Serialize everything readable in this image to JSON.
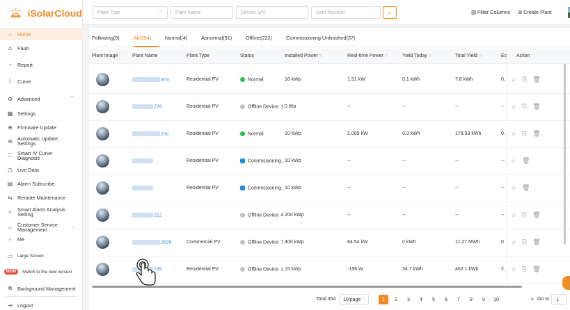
{
  "app": {
    "brand": "iSolarCloud",
    "accent": "#f08a24"
  },
  "sidebar": {
    "items": [
      {
        "label": "Home",
        "icon": "home-icon",
        "glyph": "⌂",
        "active": true
      },
      {
        "label": "Fault",
        "icon": "warning-icon",
        "glyph": "⚠"
      },
      {
        "label": "Report",
        "icon": "report-icon",
        "glyph": "◔"
      },
      {
        "label": "Curve",
        "icon": "curve-icon",
        "glyph": "⌇"
      },
      {
        "label": "Advanced",
        "icon": "advanced-icon",
        "glyph": "⚙",
        "chevron": "﹀"
      },
      {
        "label": "Settings",
        "icon": "settings-icon",
        "glyph": "▦"
      },
      {
        "label": "Firmware Update",
        "icon": "firmware-icon",
        "glyph": "⊕"
      },
      {
        "label": "Automatic Update Settings",
        "icon": "auto-update-icon",
        "glyph": "⊛"
      },
      {
        "label": "Smart IV Curve Diagnosis",
        "icon": "diagnosis-icon",
        "glyph": "⛶"
      },
      {
        "label": "Live Data",
        "icon": "live-data-icon",
        "glyph": "◷"
      },
      {
        "label": "Alarm Subscribe",
        "icon": "alarm-subscribe-icon",
        "glyph": "▤"
      },
      {
        "label": "Remote Maintenance",
        "icon": "remote-maintenance-icon",
        "glyph": "⇆"
      },
      {
        "label": "Smart Alarm Analysis Setting",
        "icon": "alarm-analysis-icon",
        "glyph": "✧"
      },
      {
        "label": "Customer Service Management",
        "icon": "customer-service-icon",
        "glyph": "∩",
        "chevron": "›"
      },
      {
        "label": "Me",
        "icon": "user-icon",
        "glyph": "●"
      }
    ],
    "bottom": {
      "large_screen": "Large Screen",
      "new_badge": "NEW",
      "switch_version": "Switch to the new version",
      "background_management": "Background Management",
      "logout": "Logout"
    }
  },
  "filters": {
    "plant_type": "Plant Type",
    "plant_name": "Plant Name",
    "device_sn": "Device S/N",
    "user_account": "User Account",
    "filter_columns": "Filter Columns",
    "create_plant": "Create Plant"
  },
  "tabs": [
    {
      "label": "Following(9)"
    },
    {
      "label": "All(354)",
      "active": true
    },
    {
      "label": "Normal(4)"
    },
    {
      "label": "Abnormal(91)"
    },
    {
      "label": "Offline(222)"
    },
    {
      "label": "Commissioning Unfinished(37)"
    }
  ],
  "columns": [
    "Plant Image",
    "Plant Name",
    "Plant Type",
    "Status",
    "Installed Power",
    "Real-time Power",
    "Yield Today",
    "Total Yield",
    "Ec",
    "Action"
  ],
  "rows": [
    {
      "name": "arm",
      "type": "Residential PV",
      "status": "Normal",
      "status_kind": "green",
      "installed": "10 kWp",
      "realtime": "1.51 kW",
      "today": "0.1 kWh",
      "total": "7.8 kWh",
      "ec": "0.",
      "actions": 3
    },
    {
      "name": "276",
      "type": "Residential PV",
      "status": "Offline Device: 1",
      "status_kind": "grey",
      "installed": "0 Wp",
      "realtime": "--",
      "today": "--",
      "total": "--",
      "ec": "--",
      "actions": 3
    },
    {
      "name": "zmj",
      "type": "Residential PV",
      "status": "Normal",
      "status_kind": "green",
      "installed": "10 kWp",
      "realtime": "2.069 kW",
      "today": "0.3 kWh",
      "total": "178.93 kWh",
      "ec": "0.",
      "actions": 3
    },
    {
      "name": "",
      "type": "Residential PV",
      "status": "Commissioning...",
      "status_kind": "blue",
      "installed": "10 kWp",
      "realtime": "--",
      "today": "--",
      "total": "--",
      "ec": "--",
      "actions": 2
    },
    {
      "name": "",
      "type": "Residential PV",
      "status": "Commissioning...",
      "status_kind": "blue",
      "installed": "10 kWp",
      "realtime": "--",
      "today": "--",
      "total": "--",
      "ec": "--",
      "actions": 2
    },
    {
      "name": "212",
      "type": "",
      "status": "Offline Device: 4",
      "status_kind": "grey",
      "installed": "200 kWp",
      "realtime": "--",
      "today": "--",
      "total": "--",
      "ec": "--",
      "actions": 3
    },
    {
      "name": "2628",
      "type": "Commercial PV",
      "status": "Offline Device: 7",
      "status_kind": "grey",
      "installed": "400 kWp",
      "realtime": "84.54 kW",
      "today": "0 kWh",
      "total": "11.27 MWh",
      "ec": "0",
      "actions": 3
    },
    {
      "name": "745",
      "type": "Residential PV",
      "status": "Offline Device: 1",
      "status_kind": "grey",
      "installed": "15 kWp",
      "realtime": "-156 W",
      "today": "34.7 kWh",
      "total": "462.1 kWh",
      "ec": "2.",
      "actions": 3
    }
  ],
  "pagination": {
    "total": "Total 354",
    "page_size": "10/page",
    "pages": [
      "1",
      "2",
      "3",
      "4",
      "5",
      "6",
      "7",
      "8",
      "9",
      "10"
    ],
    "current": "1",
    "next": ">",
    "goto_label": "Go to",
    "goto_value": "1"
  }
}
